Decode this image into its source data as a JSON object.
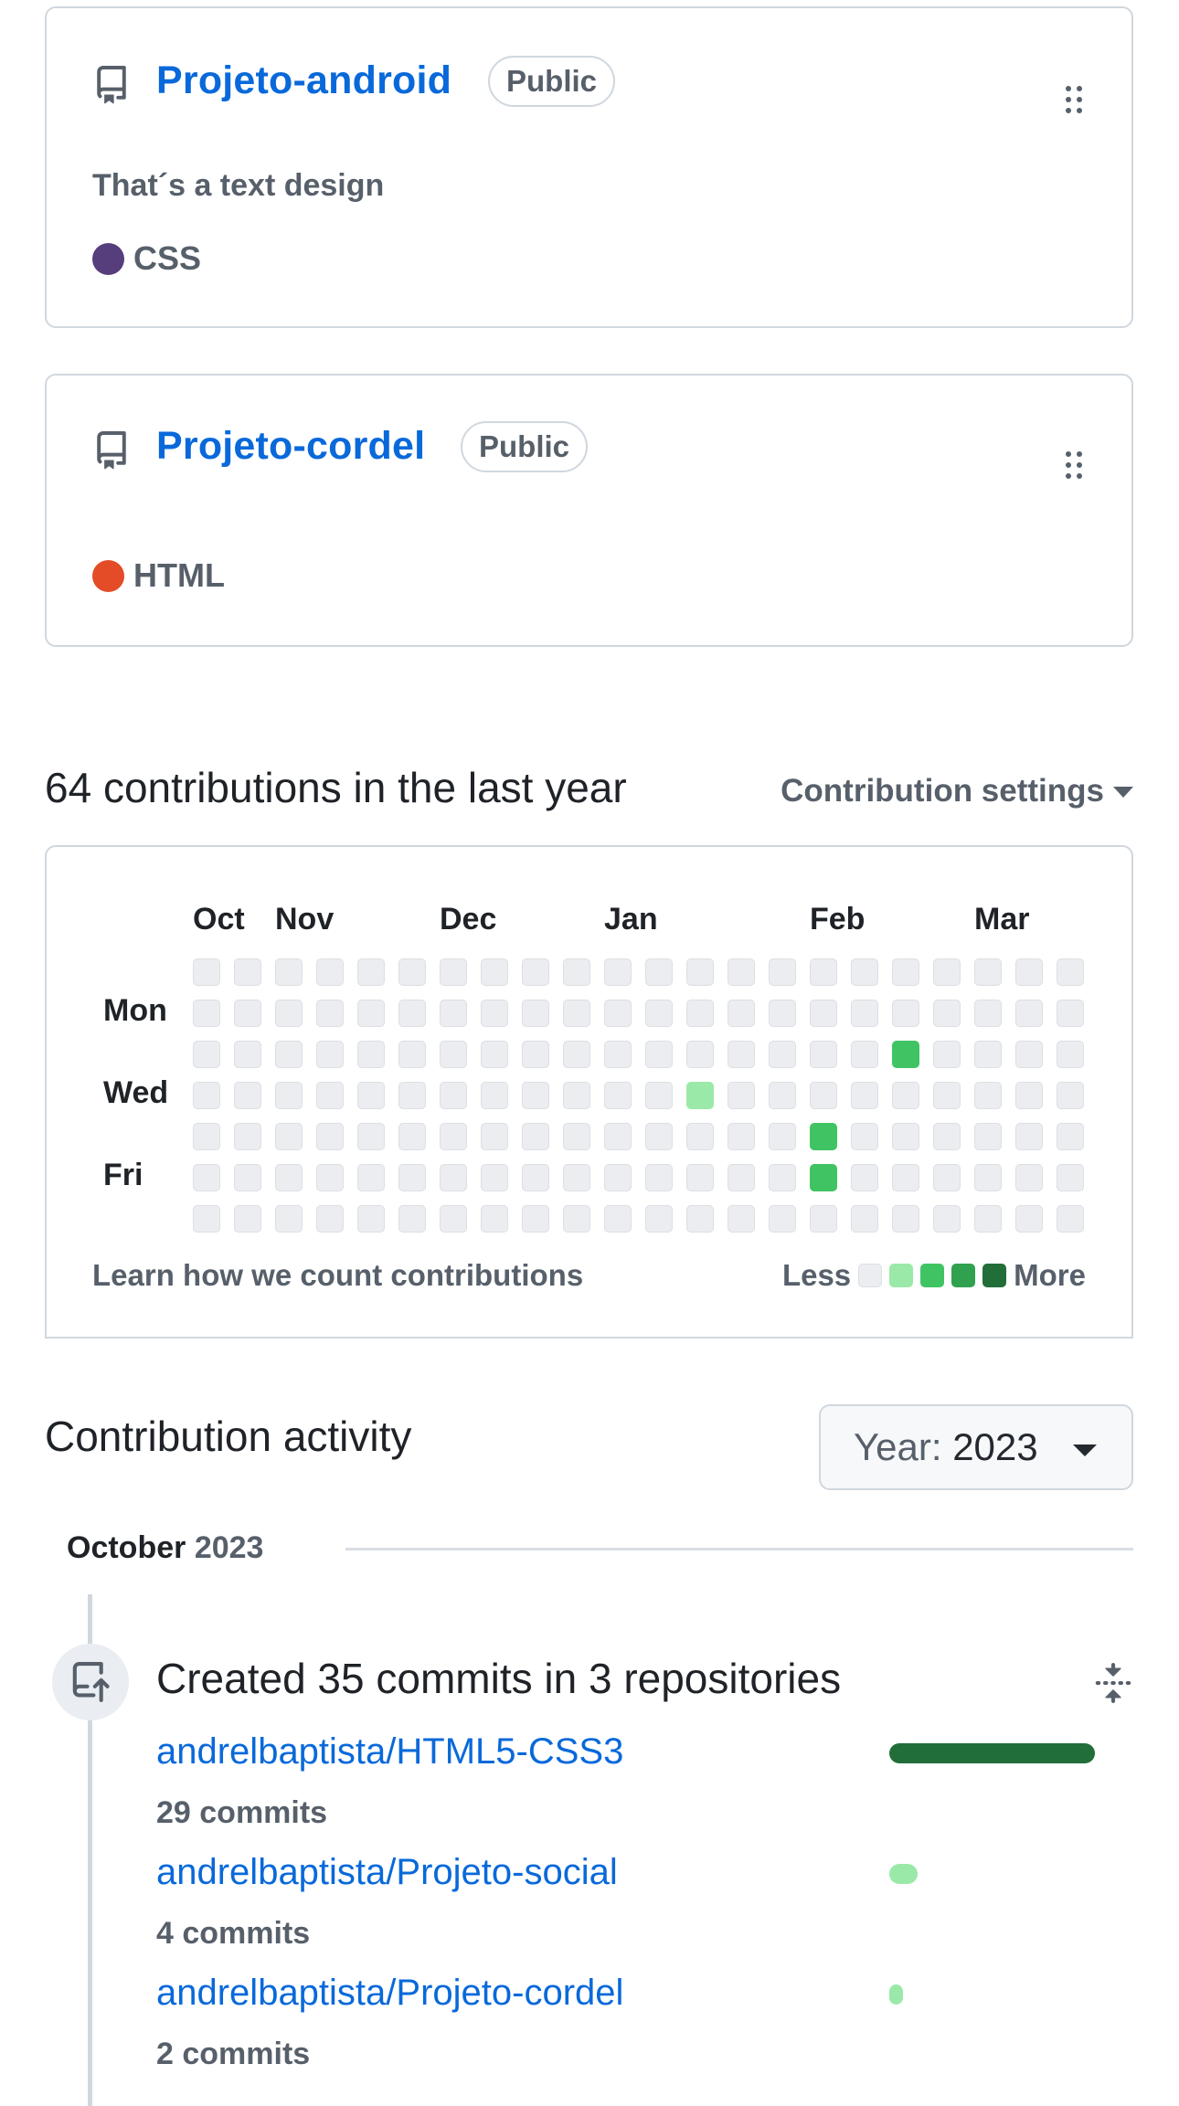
{
  "repos": [
    {
      "name": "Projeto-android",
      "visibility": "Public",
      "description": "That´s a text design",
      "language": "CSS",
      "language_color": "#563d7c"
    },
    {
      "name": "Projeto-cordel",
      "visibility": "Public",
      "description": "",
      "language": "HTML",
      "language_color": "#e34c26"
    }
  ],
  "contributions": {
    "heading": "64 contributions in the last year",
    "settings_label": "Contribution settings",
    "months": [
      "Oct",
      "Nov",
      "Dec",
      "Jan",
      "Feb",
      "Mar"
    ],
    "days": [
      "Mon",
      "Wed",
      "Fri"
    ],
    "learn_link": "Learn how we count contributions",
    "legend_less": "Less",
    "legend_more": "More",
    "level_colors": [
      "#ebedf0",
      "#9be9a8",
      "#40c463",
      "#30a14e",
      "#216e39"
    ],
    "active_cells": [
      {
        "week": 12,
        "day": 3,
        "level": 1
      },
      {
        "week": 15,
        "day": 4,
        "level": 2
      },
      {
        "week": 15,
        "day": 5,
        "level": 2
      },
      {
        "week": 17,
        "day": 2,
        "level": 2
      }
    ]
  },
  "activity": {
    "heading": "Contribution activity",
    "year_label": "Year:",
    "year_value": "2023",
    "month": "October",
    "month_year": "2023",
    "summary": "Created 35 commits in 3 repositories",
    "items": [
      {
        "repo": "andrelbaptista/HTML5-CSS3",
        "commits": "29 commits",
        "share": 0.829,
        "color": "#216e39"
      },
      {
        "repo": "andrelbaptista/Projeto-social",
        "commits": "4 commits",
        "share": 0.114,
        "color": "#9be9a8"
      },
      {
        "repo": "andrelbaptista/Projeto-cordel",
        "commits": "2 commits",
        "share": 0.057,
        "color": "#9be9a8"
      }
    ]
  }
}
